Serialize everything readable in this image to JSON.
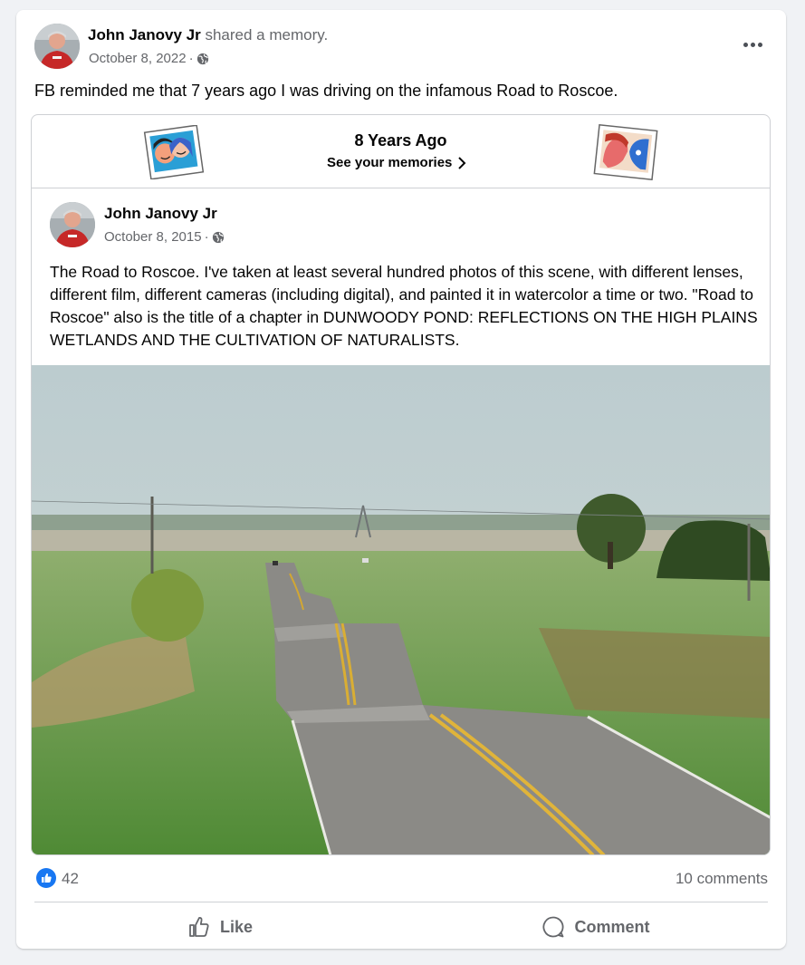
{
  "post": {
    "author": "John Janovy Jr",
    "action": "shared a memory.",
    "date": "October 8, 2022",
    "privacy_icon": "globe-icon",
    "text": "FB reminded me that 7 years ago I was driving on the infamous Road to Roscoe."
  },
  "memory": {
    "title": "8 Years Ago",
    "link": "See your memories",
    "original": {
      "author": "John Janovy Jr",
      "date": "October 8, 2015",
      "text": "The Road to Roscoe. I've taken at least several hundred photos of this scene, with different lenses, different film, different cameras (including digital), and painted it in watercolor a time or two. \"Road to Roscoe\" also is the title of a chapter in DUNWOODY POND: REFLECTIONS ON THE HIGH PLAINS WETLANDS AND THE CULTIVATION OF NATURALISTS."
    }
  },
  "stats": {
    "likes": "42",
    "comments": "10 comments"
  },
  "actions": {
    "like": "Like",
    "comment": "Comment"
  },
  "colors": {
    "accent": "#1877f2",
    "secondary_text": "#65676b",
    "background": "#f0f2f5"
  }
}
